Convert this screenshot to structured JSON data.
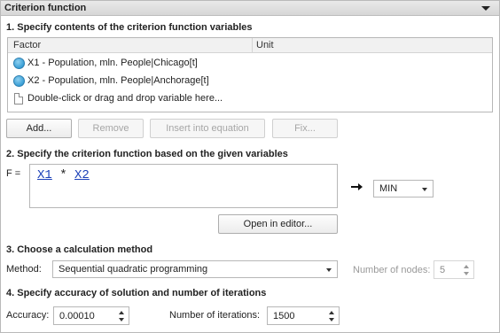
{
  "panel": {
    "title": "Criterion function"
  },
  "section1": {
    "title": "1. Specify contents of the criterion function variables",
    "columns": [
      "Factor",
      "Unit"
    ],
    "rows": [
      {
        "factor": "X1 - Population, mln. People|Chicago[t]",
        "unit": ""
      },
      {
        "factor": "X2 - Population, mln. People|Anchorage[t]",
        "unit": ""
      }
    ],
    "placeholder": "Double-click or drag and drop variable here...",
    "buttons": {
      "add": "Add...",
      "remove": "Remove",
      "insert": "Insert into equation",
      "fix": "Fix..."
    }
  },
  "section2": {
    "title": "2. Specify the criterion function based on the given variables",
    "f_label": "F =",
    "formula": {
      "var1": "X1",
      "op": "*",
      "var2": "X2"
    },
    "direction": "MIN",
    "open_editor": "Open in editor..."
  },
  "section3": {
    "title": "3. Choose a calculation method",
    "method_label": "Method:",
    "method_value": "Sequential quadratic programming",
    "nodes_label": "Number of nodes:",
    "nodes_value": "5"
  },
  "section4": {
    "title": "4. Specify accuracy of solution and number of iterations",
    "accuracy_label": "Accuracy:",
    "accuracy_value": "0.00010",
    "iterations_label": "Number of iterations:",
    "iterations_value": "1500"
  },
  "colors": {
    "accent_link": "#1a3fb8",
    "icon_blue": "#3a9fd6"
  }
}
